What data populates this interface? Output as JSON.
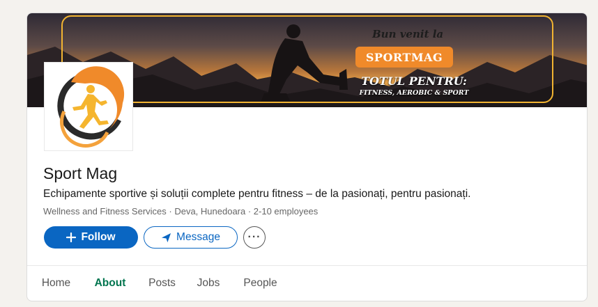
{
  "banner": {
    "welcome": "Bun venit la",
    "brand": "SPORTMAG",
    "headline": "TOTUL PENTRU:",
    "subline": "FITNESS, AEROBIC & SPORT"
  },
  "company": {
    "name": "Sport Mag",
    "description": "Echipamente sportive și soluții complete pentru fitness – de la pasionați, pentru pasionați.",
    "meta": "Wellness and Fitness Services · Deva, Hunedoara · 2-10 employees"
  },
  "actions": {
    "follow_label": "Follow",
    "message_label": "Message",
    "more_label": "···"
  },
  "tabs": [
    {
      "label": "Home",
      "active": false
    },
    {
      "label": "About",
      "active": true
    },
    {
      "label": "Posts",
      "active": false
    },
    {
      "label": "Jobs",
      "active": false
    },
    {
      "label": "People",
      "active": false
    }
  ],
  "colors": {
    "primary": "#0a66c2",
    "active_tab": "#01754f",
    "logo_orange": "#f08a2a"
  },
  "icons": [
    "plus-icon",
    "send-icon",
    "more-icon"
  ]
}
